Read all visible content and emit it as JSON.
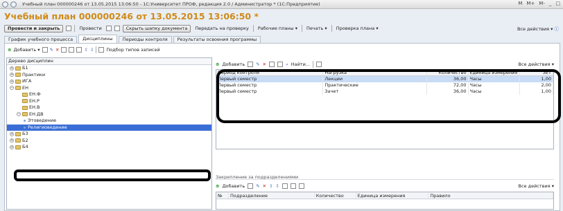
{
  "window": {
    "title": "Учебный план 000000246 от 13.05.2015 13:06:50 - 1С:Университет ПРОФ, редакция 2.0 / Администратор * (1С:Предприятие)",
    "right_controls": [
      "M",
      "M+",
      "M-",
      "_",
      "□"
    ]
  },
  "doc_title": "Учебный план 000000246 от 13.05.2015 13:06:50 *",
  "toolbar": {
    "post_close": "Провести и закрыть",
    "post": "Провести",
    "hide_header": "Скрыть шапку документа",
    "send_check": "Передать на проверку",
    "work_plans": "Рабочие планы",
    "print": "Печать",
    "plan_check": "Проверка плана",
    "all_actions": "Все действия"
  },
  "tabs": [
    "График учебного процесса",
    "Дисциплины",
    "Периоды контроля",
    "Результаты освоения программы"
  ],
  "left": {
    "add": "Добавить",
    "pick_types": "Подбор типов записей",
    "tree_header": "Дерево дисциплин",
    "nodes": [
      {
        "label": "Б1",
        "level": 0,
        "exp": "+",
        "kind": "folder"
      },
      {
        "label": "Практики",
        "level": 0,
        "exp": "+",
        "kind": "folder"
      },
      {
        "label": "ИГА",
        "level": 0,
        "exp": "+",
        "kind": "folder"
      },
      {
        "label": "ЕН",
        "level": 0,
        "exp": "−",
        "kind": "folder"
      },
      {
        "label": "ЕН.Ф",
        "level": 1,
        "exp": "",
        "kind": "folder"
      },
      {
        "label": "ЕН.Р",
        "level": 1,
        "exp": "",
        "kind": "folder"
      },
      {
        "label": "ЕН.В",
        "level": 1,
        "exp": "",
        "kind": "folder"
      },
      {
        "label": "ЕН.ДВ",
        "level": 1,
        "exp": "−",
        "kind": "folder"
      },
      {
        "label": "Этоведение",
        "level": 2,
        "exp": "",
        "kind": "item"
      },
      {
        "label": "Религиоведение",
        "level": 2,
        "exp": "",
        "kind": "item",
        "selected": true
      },
      {
        "label": "Б3",
        "level": 0,
        "exp": "+",
        "kind": "folder"
      },
      {
        "label": "Б2",
        "level": 0,
        "exp": "+",
        "kind": "folder"
      },
      {
        "label": "Б4",
        "level": 0,
        "exp": "+",
        "kind": "folder"
      }
    ]
  },
  "right": {
    "add": "Добавить",
    "find": "Найти...",
    "all_actions": "Все действия",
    "columns": [
      "Период контроля",
      "Нагрузка",
      "Количество",
      "Единица измерения",
      "ЗЕТ"
    ],
    "rows": [
      [
        "Первый семестр",
        "Лекции",
        "36,00",
        "Часы",
        "1,00"
      ],
      [
        "Первый семестр",
        "Практические",
        "72,00",
        "Часы",
        "2,00"
      ],
      [
        "Первый семестр",
        "Зачет",
        "36,00",
        "Часы",
        "1,00"
      ]
    ]
  },
  "bottom": {
    "label": "Закрепление за подразделениями",
    "add": "Добавить",
    "all_actions": "Все действия",
    "columns": [
      "№",
      "Подразделение",
      "Количество",
      "Единица измерения",
      "Правило"
    ]
  }
}
